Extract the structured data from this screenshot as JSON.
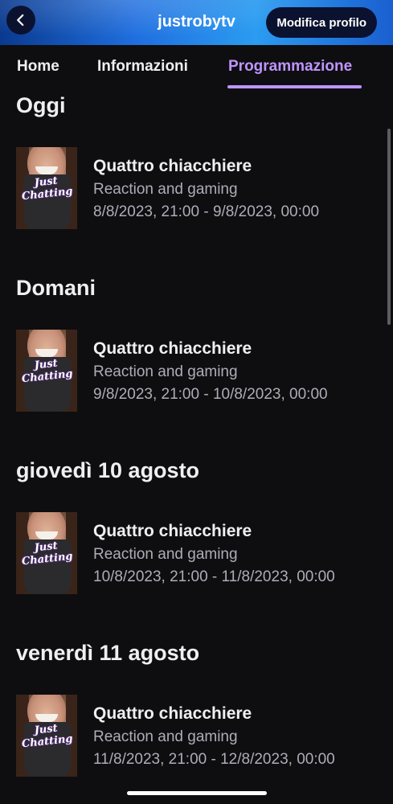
{
  "header": {
    "back_icon": "chevron-left-icon",
    "channel_name": "justrobytv",
    "edit_profile_label": "Modifica profilo"
  },
  "tabs": [
    {
      "label": "Home"
    },
    {
      "label": "Informazioni"
    },
    {
      "label": "Programmazione",
      "active": true
    }
  ],
  "colors": {
    "accent": "#bf94ff",
    "background": "#0e0e10",
    "header_gradient_start": "#0a3a8f",
    "header_gradient_end": "#2b9cf0"
  },
  "schedule": [
    {
      "day": "Oggi",
      "items": [
        {
          "thumb_label": "Just Chatting",
          "title": "Quattro chiacchiere",
          "category": "Reaction and gaming",
          "time": "8/8/2023, 21:00 - 9/8/2023, 00:00"
        }
      ]
    },
    {
      "day": "Domani",
      "items": [
        {
          "thumb_label": "Just Chatting",
          "title": "Quattro chiacchiere",
          "category": "Reaction and gaming",
          "time": "9/8/2023, 21:00 - 10/8/2023, 00:00"
        }
      ]
    },
    {
      "day": "giovedì 10 agosto",
      "items": [
        {
          "thumb_label": "Just Chatting",
          "title": "Quattro chiacchiere",
          "category": "Reaction and gaming",
          "time": "10/8/2023, 21:00 - 11/8/2023, 00:00"
        }
      ]
    },
    {
      "day": "venerdì 11 agosto",
      "items": [
        {
          "thumb_label": "Just Chatting",
          "title": "Quattro chiacchiere",
          "category": "Reaction and gaming",
          "time": "11/8/2023, 21:00 - 12/8/2023, 00:00"
        }
      ]
    }
  ]
}
